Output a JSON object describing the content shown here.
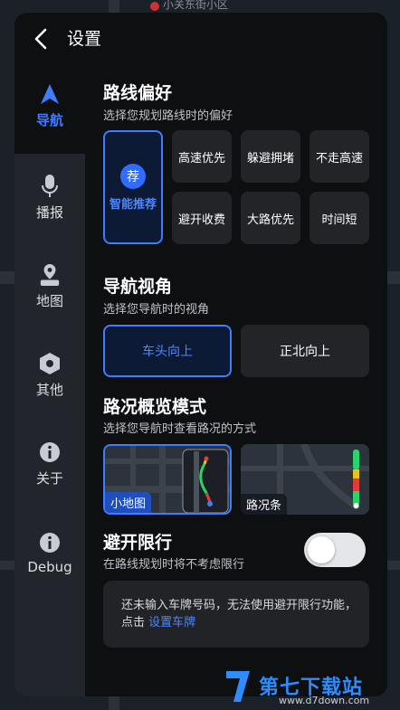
{
  "map": {
    "top_text": "小关东街小区"
  },
  "header": {
    "title": "设置"
  },
  "sidebar": {
    "items": [
      {
        "label": "导航",
        "icon": "navigation-arrow-icon",
        "active": true
      },
      {
        "label": "播报",
        "icon": "microphone-icon"
      },
      {
        "label": "地图",
        "icon": "map-pin-icon"
      },
      {
        "label": "其他",
        "icon": "hexagon-icon"
      },
      {
        "label": "关于",
        "icon": "info-icon"
      },
      {
        "label": "Debug",
        "icon": "info-icon"
      }
    ]
  },
  "route_pref": {
    "title": "路线偏好",
    "subtitle": "选择您规划路线时的偏好",
    "smart_badge": "荐",
    "smart_label": "智能推荐",
    "options": [
      "高速优先",
      "躲避拥堵",
      "不走高速",
      "避开收费",
      "大路优先",
      "时间短"
    ]
  },
  "nav_view": {
    "title": "导航视角",
    "subtitle": "选择您导航时的视角",
    "options": [
      "车头向上",
      "正北向上"
    ]
  },
  "traffic_mode": {
    "title": "路况概览模式",
    "subtitle": "选择您导航时查看路况的方式",
    "options": [
      "小地图",
      "路况条"
    ]
  },
  "avoid_restriction": {
    "title": "避开限行",
    "subtitle": "在路线规划时将不考虑限行",
    "enabled": false
  },
  "notice": {
    "text": "还未输入车牌号码，无法使用避开限行功能，点击",
    "link": "设置车牌"
  },
  "watermark": {
    "brand": "第七下载站",
    "url": "www.d7down.com"
  },
  "colors": {
    "accent": "#3f7cff",
    "panel": "#0e0f11",
    "sidebar": "#22252b",
    "card": "#232428"
  }
}
